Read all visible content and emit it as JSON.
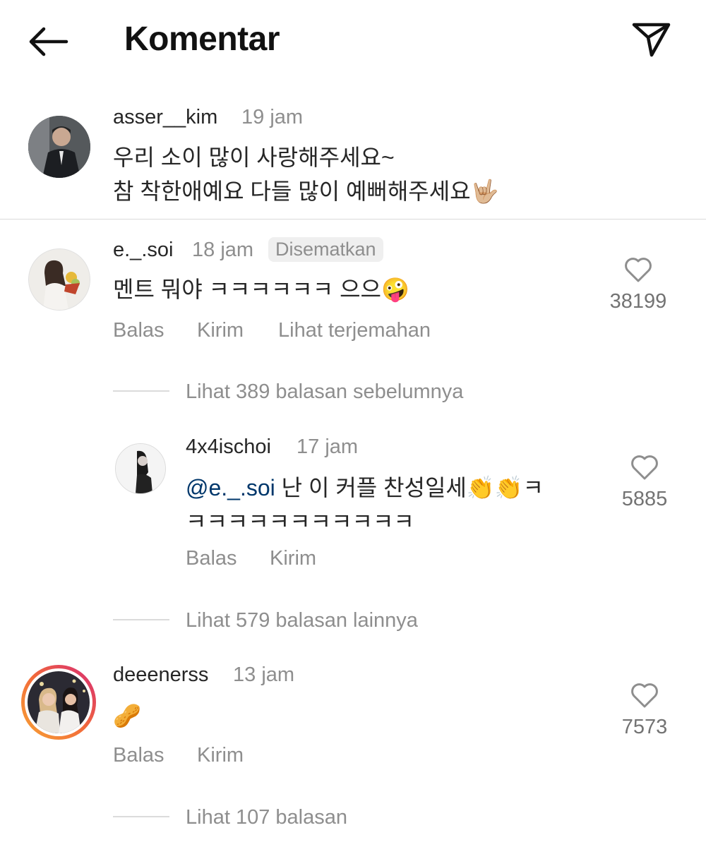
{
  "header": {
    "title": "Komentar",
    "back_icon": "arrow-left-icon",
    "send_icon": "paper-plane-icon"
  },
  "caption": {
    "username": "asser__kim",
    "time": "19 jam",
    "line1": "우리 소이 많이 사랑해주세요~",
    "line2": "참 착한애예요 다들 많이 예뻐해주세요🤟🏼"
  },
  "comments": [
    {
      "username": "e._.soi",
      "time": "18 jam",
      "pinned": "Disematkan",
      "text": "멘트 뭐야 ㅋㅋㅋㅋㅋㅋ 으으🤪",
      "likes": "38199",
      "actions": [
        "Balas",
        "Kirim",
        "Lihat terjemahan"
      ],
      "prev_replies": "Lihat 389 balasan sebelumnya",
      "reply": {
        "username": "4x4ischoi",
        "time": "17 jam",
        "mention": "@e._.soi",
        "text_line1": " 난 이 커플 찬성일세👏👏ㅋ",
        "text_line2": "ㅋㅋㅋㅋㅋㅋㅋㅋㅋㅋㅋ",
        "likes": "5885",
        "actions": [
          "Balas",
          "Kirim"
        ]
      },
      "more_replies": "Lihat 579 balasan lainnya"
    },
    {
      "username": "deeenerss",
      "time": "13 jam",
      "text": "🥜",
      "likes": "7573",
      "actions": [
        "Balas",
        "Kirim"
      ],
      "more_replies": "Lihat 107 balasan"
    }
  ],
  "colors": {
    "text": "#262626",
    "muted": "#8e8e8e",
    "mention": "#00376b",
    "story_ring_start": "#f7a334",
    "story_ring_end": "#d62976"
  }
}
